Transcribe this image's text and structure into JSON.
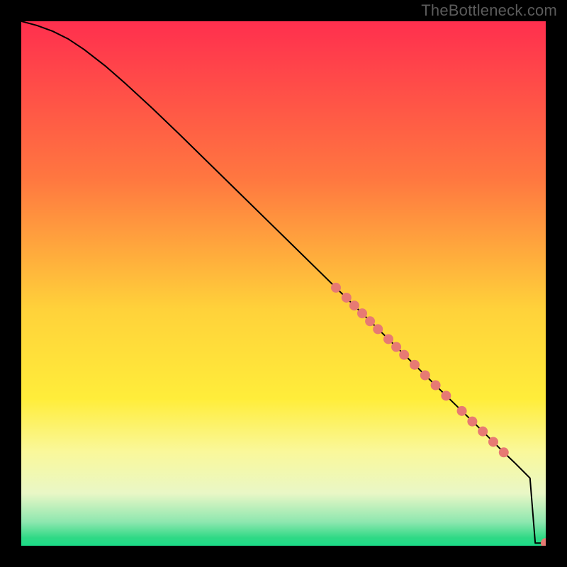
{
  "watermark": "TheBottleneck.com",
  "chart_data": {
    "type": "line",
    "title": "",
    "xlabel": "",
    "ylabel": "",
    "xlim": [
      0,
      100
    ],
    "ylim": [
      0,
      100
    ],
    "grid": false,
    "legend": false,
    "background_gradient": {
      "stops": [
        {
          "offset": 0.0,
          "color": "#ff2f4e"
        },
        {
          "offset": 0.3,
          "color": "#ff7740"
        },
        {
          "offset": 0.55,
          "color": "#ffd23a"
        },
        {
          "offset": 0.72,
          "color": "#ffed3a"
        },
        {
          "offset": 0.82,
          "color": "#faf89a"
        },
        {
          "offset": 0.9,
          "color": "#e9f7c6"
        },
        {
          "offset": 0.955,
          "color": "#8de7af"
        },
        {
          "offset": 0.985,
          "color": "#2fd985"
        },
        {
          "offset": 1.0,
          "color": "#1cdc88"
        }
      ]
    },
    "series": [
      {
        "name": "curve",
        "type": "line",
        "color": "#000000",
        "x": [
          0,
          3,
          6,
          9,
          12,
          16,
          20,
          25,
          30,
          40,
          50,
          60,
          70,
          80,
          88,
          92,
          94,
          96,
          97,
          98,
          100
        ],
        "y": [
          100,
          99.2,
          98.1,
          96.6,
          94.6,
          91.5,
          88.0,
          83.4,
          78.6,
          68.8,
          59.0,
          49.2,
          39.4,
          29.6,
          21.8,
          17.8,
          15.9,
          13.9,
          12.9,
          0.5,
          0.5
        ]
      },
      {
        "name": "highlight-points",
        "type": "scatter",
        "color": "#e77a73",
        "radius": 7,
        "x": [
          60,
          62,
          63.5,
          65,
          66.5,
          68,
          70,
          71.5,
          73,
          75,
          77,
          79,
          81,
          84,
          86,
          88,
          90,
          92,
          100,
          101.5
        ],
        "y": [
          49.2,
          47.3,
          45.8,
          44.3,
          42.8,
          41.3,
          39.4,
          37.9,
          36.4,
          34.5,
          32.5,
          30.6,
          28.6,
          25.7,
          23.7,
          21.8,
          19.8,
          17.8,
          0.5,
          0.5
        ]
      }
    ]
  }
}
